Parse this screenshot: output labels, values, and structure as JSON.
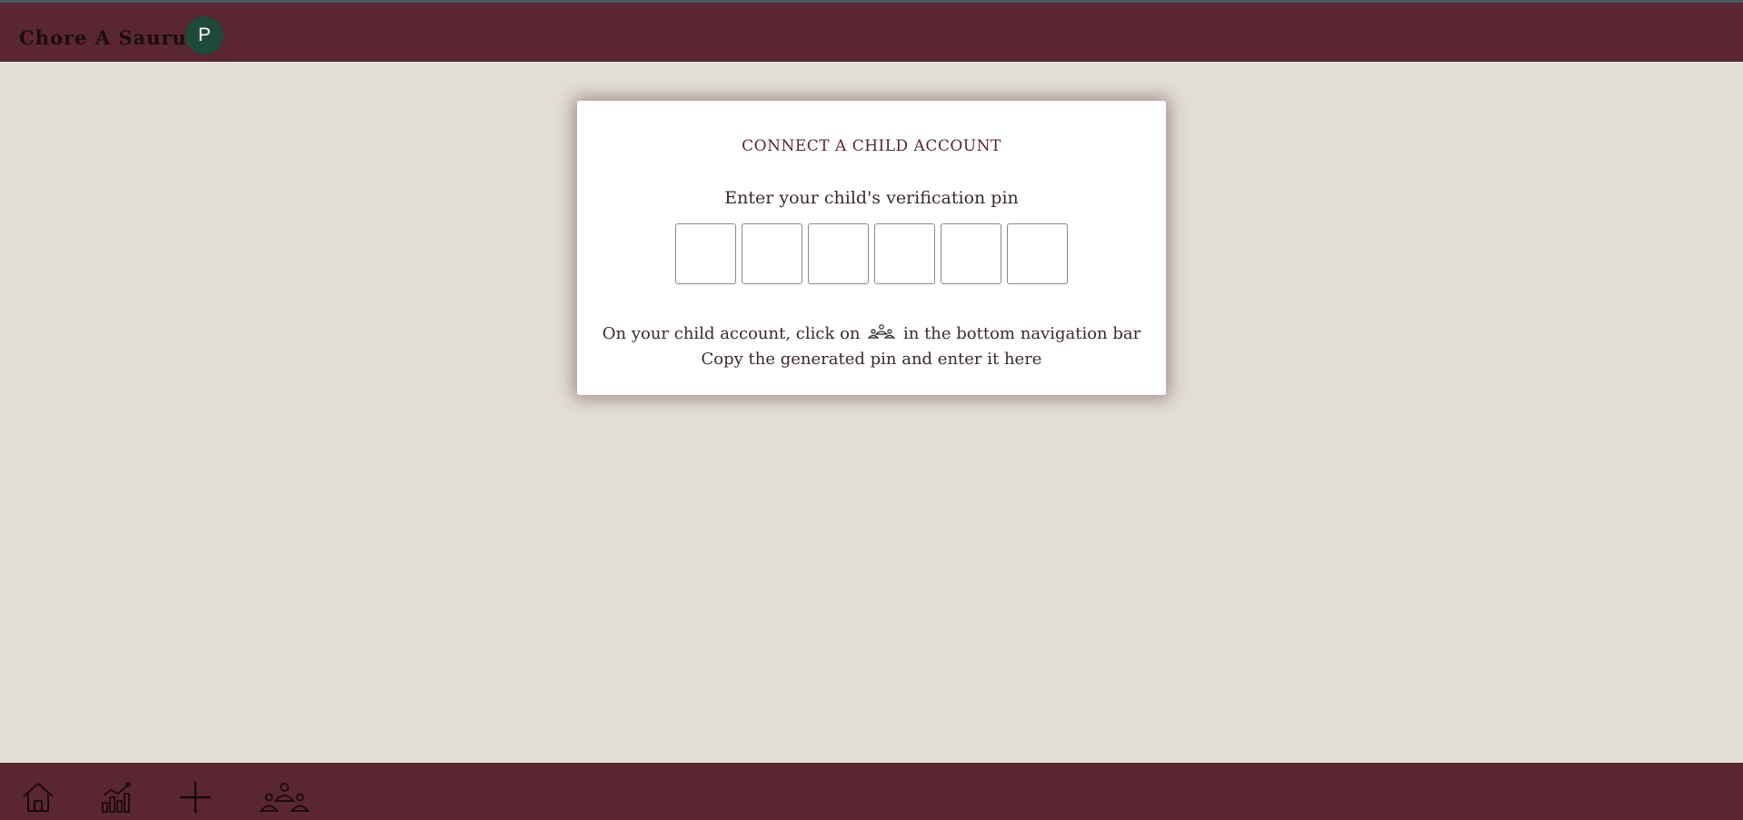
{
  "header": {
    "brand": "Chore A Saurus",
    "avatar_initial": "P"
  },
  "card": {
    "title": "CONNECT A CHILD ACCOUNT",
    "subtitle": "Enter your child's verification pin",
    "pin_digits": [
      "",
      "",
      "",
      "",
      "",
      ""
    ],
    "instruction_before_icon": "On your child account, click on",
    "instruction_icon": "family-icon",
    "instruction_after_icon": "in the bottom navigation bar",
    "instruction_line2": "Copy the generated pin and enter it here"
  },
  "bottom_nav": {
    "items": [
      {
        "name": "home",
        "icon": "home-icon"
      },
      {
        "name": "stats",
        "icon": "chart-icon"
      },
      {
        "name": "add",
        "icon": "plus-icon"
      },
      {
        "name": "family",
        "icon": "family-icon"
      }
    ]
  },
  "colors": {
    "header_bg": "#5a2632",
    "page_bg": "#e2ded3",
    "avatar_bg": "#1f4a3b",
    "card_bg": "#ffffff",
    "title_color": "#5a2632"
  }
}
